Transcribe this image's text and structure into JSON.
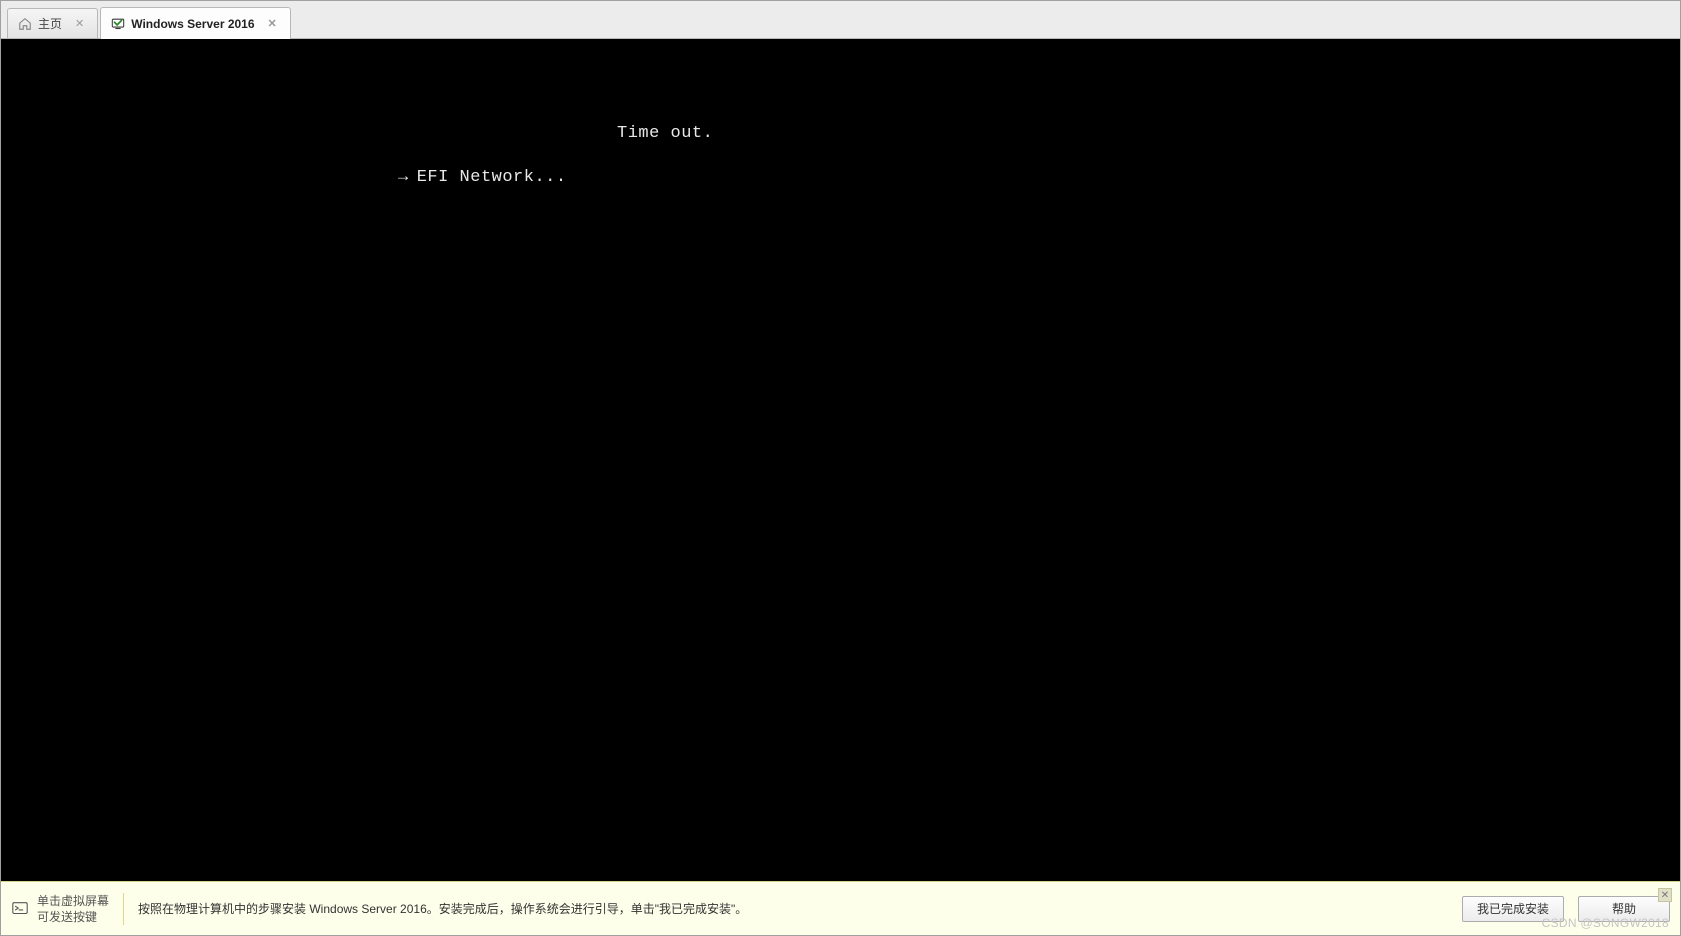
{
  "tabs": {
    "home": {
      "label": "主页"
    },
    "vm": {
      "label": "Windows Server 2016"
    }
  },
  "console": {
    "timeout_line": "Time out.",
    "efi_line": "EFI Network..."
  },
  "bottombar": {
    "hint_line1": "单击虚拟屏幕",
    "hint_line2": "可发送按键",
    "message": "按照在物理计算机中的步骤安装 Windows Server 2016。安装完成后，操作系统会进行引导，单击\"我已完成安装\"。",
    "finish_label": "我已完成安装",
    "help_label": "帮助"
  },
  "watermark": "CSDN @SONGW2018"
}
